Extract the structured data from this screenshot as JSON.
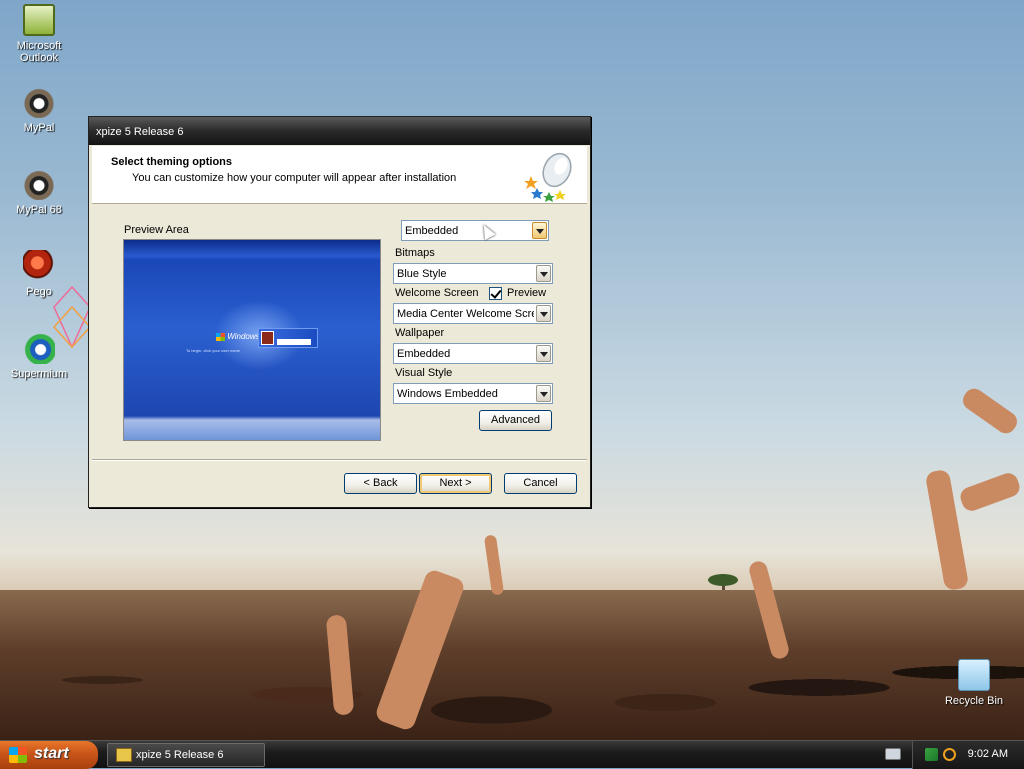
{
  "desktop": {
    "icons": [
      {
        "label": "Microsoft Outlook"
      },
      {
        "label": "MyPal"
      },
      {
        "label": "MyPal 68"
      },
      {
        "label": "Pego"
      },
      {
        "label": "Supermium"
      },
      {
        "label": "Recycle Bin"
      }
    ]
  },
  "window": {
    "title": "xpize 5 Release 6",
    "header_title": "Select theming options",
    "header_subtitle": "You can customize how your computer will appear after installation",
    "preview_label": "Preview Area",
    "preview_screen": {
      "logo_text": "Windows",
      "prompt": "To begin, click your user name"
    },
    "theme_select": {
      "value": "Embedded"
    },
    "bitmaps": {
      "label": "Bitmaps",
      "value": "Blue Style"
    },
    "welcome_screen": {
      "label": "Welcome Screen",
      "preview_label": "Preview",
      "preview_checked": true,
      "value": "Media Center Welcome Scree"
    },
    "wallpaper": {
      "label": "Wallpaper",
      "value": "Embedded"
    },
    "visual_style": {
      "label": "Visual Style",
      "value": "Windows Embedded"
    },
    "advanced_label": "Advanced",
    "back_label": "< Back",
    "next_label": "Next >",
    "cancel_label": "Cancel"
  },
  "taskbar": {
    "start_label": "start",
    "task_label": "xpize 5 Release 6",
    "clock": "9:02 AM"
  }
}
